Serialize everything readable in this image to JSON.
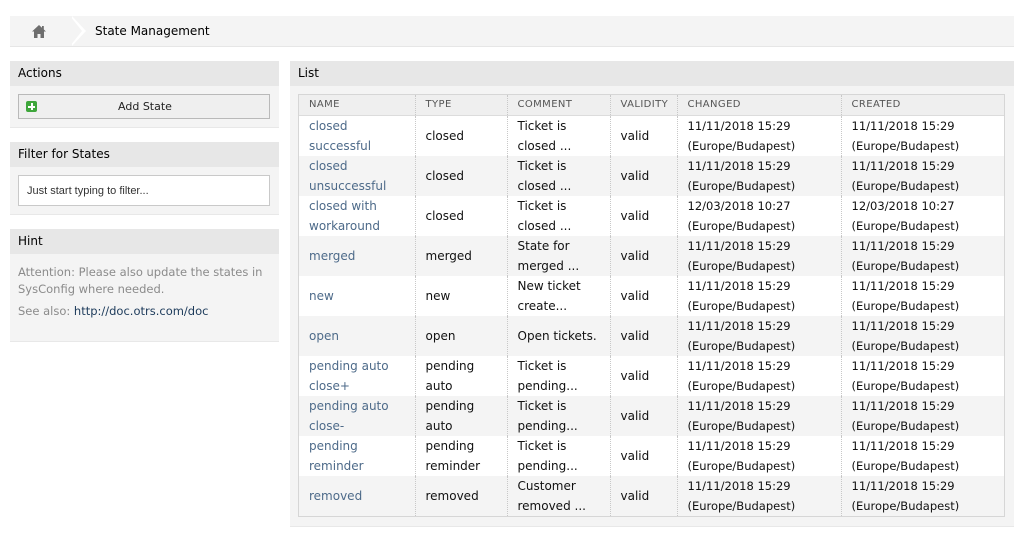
{
  "breadcrumb": {
    "home_icon": "home-icon",
    "current": "State Management"
  },
  "sidebar": {
    "actions": {
      "title": "Actions",
      "add_button_icon": "plus-square-icon",
      "add_button_label": "Add State"
    },
    "filter": {
      "title": "Filter for States",
      "placeholder": "Just start typing to filter..."
    },
    "hint": {
      "title": "Hint",
      "text": "Attention: Please also update the states in SysConfig where needed.",
      "see_also_label": "See also:",
      "see_also_link": "http://doc.otrs.com/doc"
    }
  },
  "list": {
    "title": "List",
    "columns": [
      "NAME",
      "TYPE",
      "COMMENT",
      "VALIDITY",
      "CHANGED",
      "CREATED"
    ],
    "rows": [
      {
        "name": "closed successful",
        "type": "closed",
        "comment": "Ticket is closed ...",
        "validity": "valid",
        "changed": "11/11/2018 15:29 (Europe/Budapest)",
        "created": "11/11/2018 15:29 (Europe/Budapest)"
      },
      {
        "name": "closed unsuccessful",
        "type": "closed",
        "comment": "Ticket is closed ...",
        "validity": "valid",
        "changed": "11/11/2018 15:29 (Europe/Budapest)",
        "created": "11/11/2018 15:29 (Europe/Budapest)"
      },
      {
        "name": "closed with workaround",
        "type": "closed",
        "comment": "Ticket is closed ...",
        "validity": "valid",
        "changed": "12/03/2018 10:27 (Europe/Budapest)",
        "created": "12/03/2018 10:27 (Europe/Budapest)"
      },
      {
        "name": "merged",
        "type": "merged",
        "comment": "State for merged ...",
        "validity": "valid",
        "changed": "11/11/2018 15:29 (Europe/Budapest)",
        "created": "11/11/2018 15:29 (Europe/Budapest)"
      },
      {
        "name": "new",
        "type": "new",
        "comment": "New ticket create...",
        "validity": "valid",
        "changed": "11/11/2018 15:29 (Europe/Budapest)",
        "created": "11/11/2018 15:29 (Europe/Budapest)"
      },
      {
        "name": "open",
        "type": "open",
        "comment": "Open tickets.",
        "validity": "valid",
        "changed": "11/11/2018 15:29 (Europe/Budapest)",
        "created": "11/11/2018 15:29 (Europe/Budapest)"
      },
      {
        "name": "pending auto close+",
        "type": "pending auto",
        "comment": "Ticket is pending...",
        "validity": "valid",
        "changed": "11/11/2018 15:29 (Europe/Budapest)",
        "created": "11/11/2018 15:29 (Europe/Budapest)"
      },
      {
        "name": "pending auto close-",
        "type": "pending auto",
        "comment": "Ticket is pending...",
        "validity": "valid",
        "changed": "11/11/2018 15:29 (Europe/Budapest)",
        "created": "11/11/2018 15:29 (Europe/Budapest)"
      },
      {
        "name": "pending reminder",
        "type": "pending reminder",
        "comment": "Ticket is pending...",
        "validity": "valid",
        "changed": "11/11/2018 15:29 (Europe/Budapest)",
        "created": "11/11/2018 15:29 (Europe/Budapest)"
      },
      {
        "name": "removed",
        "type": "removed",
        "comment": "Customer removed ...",
        "validity": "valid",
        "changed": "11/11/2018 15:29 (Europe/Budapest)",
        "created": "11/11/2018 15:29 (Europe/Budapest)"
      }
    ]
  },
  "colors": {
    "link": "#4d6a89",
    "add_icon": "#3ea63b",
    "panel_bg": "#f4f4f4",
    "header_bg": "#e7e7e7"
  }
}
